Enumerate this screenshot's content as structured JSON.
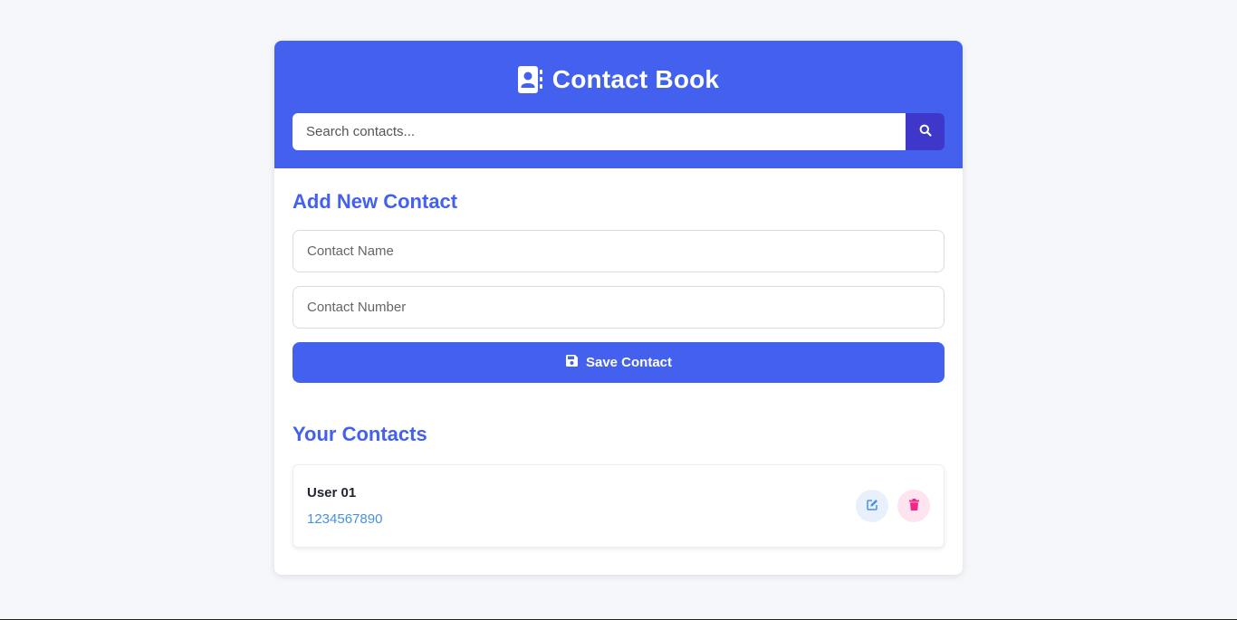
{
  "header": {
    "title": "Contact Book",
    "title_icon": "address-book-icon",
    "search_placeholder": "Search contacts...",
    "search_icon": "search-icon"
  },
  "add_form": {
    "title": "Add New Contact",
    "name_placeholder": "Contact Name",
    "number_placeholder": "Contact Number",
    "save_label": "Save Contact",
    "save_icon": "floppy-disk-icon"
  },
  "contacts": {
    "title": "Your Contacts",
    "items": [
      {
        "name": "User 01",
        "number": "1234567890"
      }
    ]
  },
  "colors": {
    "primary": "#4361ee",
    "search_button": "#3f37c9",
    "number_text": "#4a90e2",
    "edit_accent": "#4a90e2",
    "delete_accent": "#f72585",
    "background": "#f5f7fa"
  }
}
